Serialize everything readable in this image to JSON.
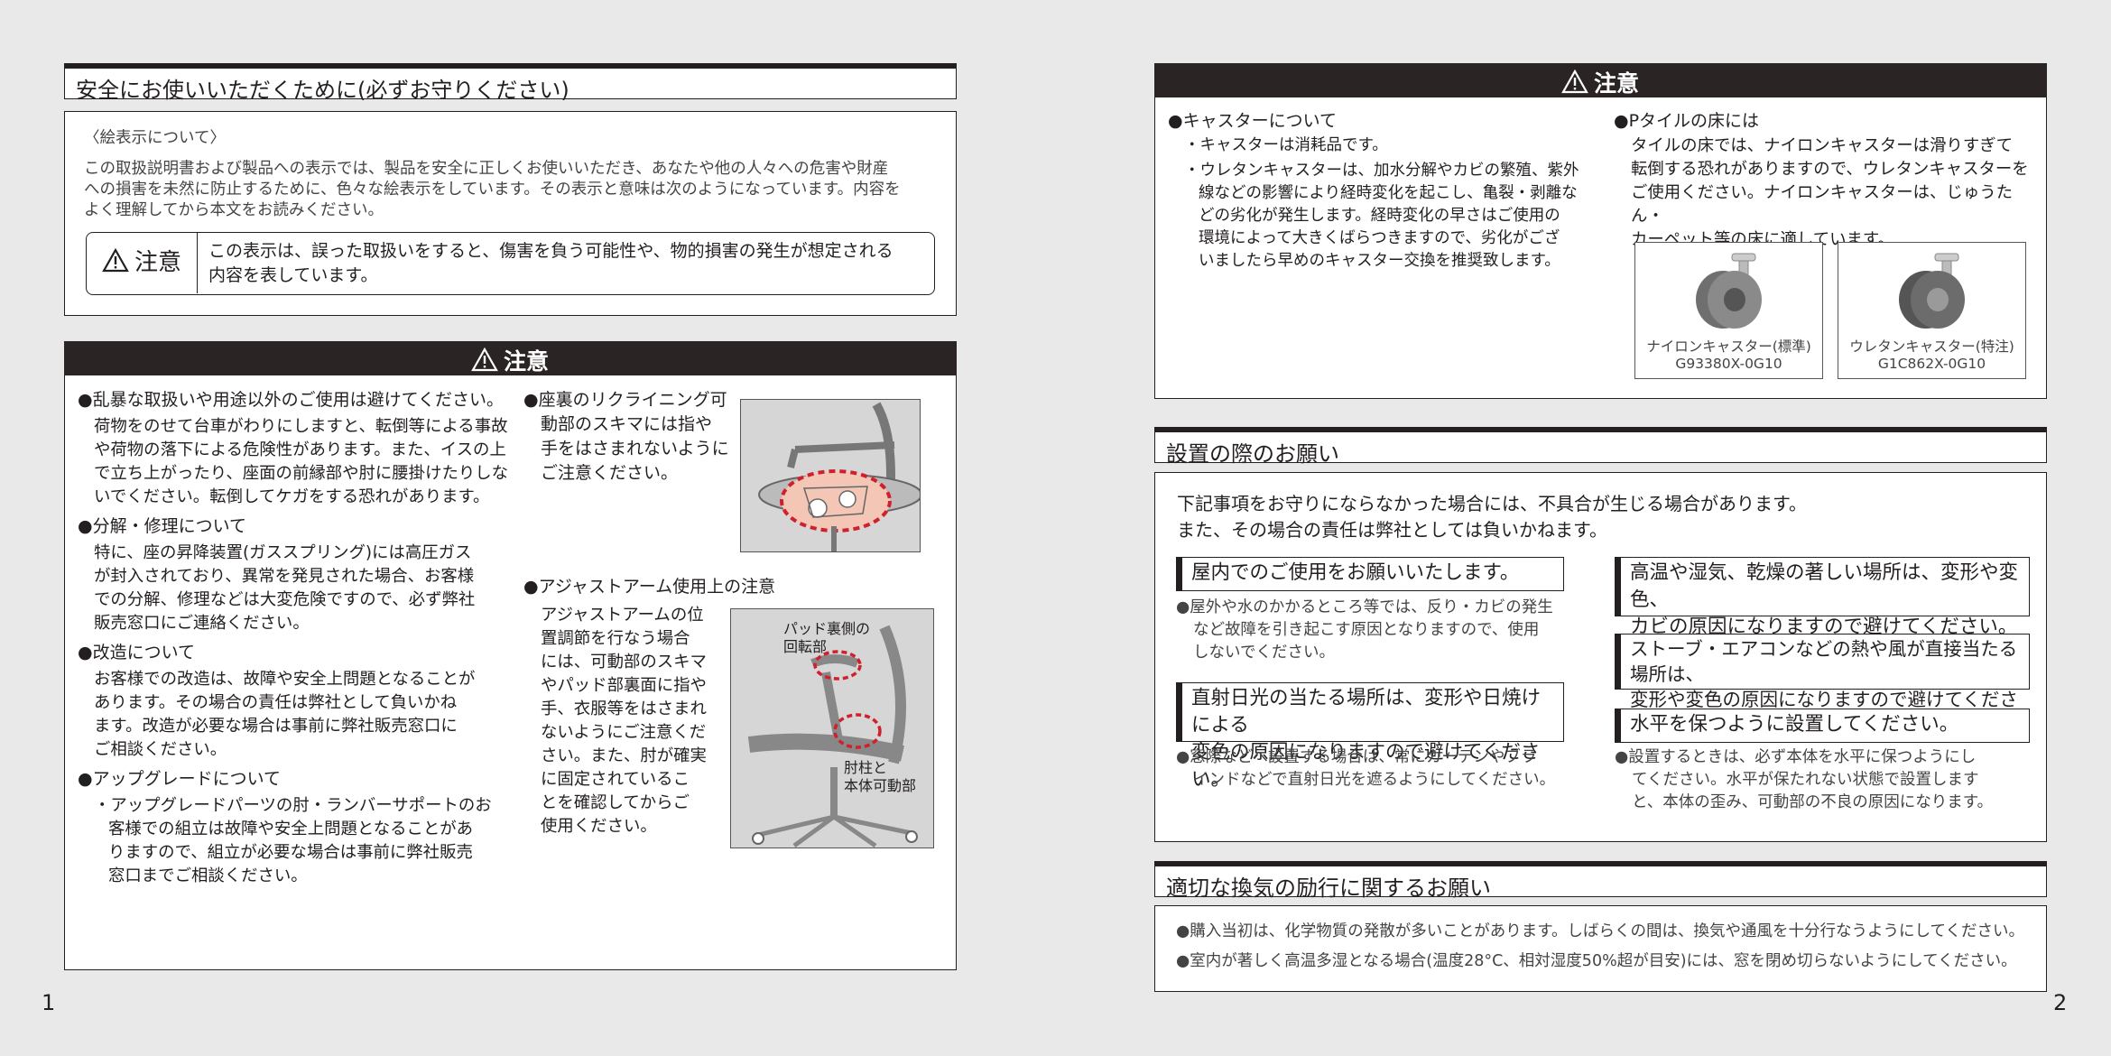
{
  "left": {
    "title": "安全にお使いいただくために(必ずお守りください)",
    "symbols": {
      "heading": "〈絵表示について〉",
      "line1": "この取扱説明書および製品への表示では、製品を安全に正しくお使いいただき、あなたや他の人々への危害や財産",
      "line2": "への損害を未然に防止するために、色々な絵表示をしています。その表示と意味は次のようになっています。内容を",
      "line3": "よく理解してから本文をお読みください。",
      "badge": "注意",
      "def1": "この表示は、誤った取扱いをすると、傷害を負う可能性や、物的損害の発生が想定される",
      "def2": "内容を表しています。"
    },
    "caution": {
      "header": "注意",
      "s1_head": "●乱暴な取扱いや用途以外のご使用は避けてください。",
      "s1_l1": "荷物をのせて台車がわりにしますと、転倒等による事故",
      "s1_l2": "や荷物の落下による危険性があります。また、イスの上",
      "s1_l3": "で立ち上がったり、座面の前縁部や肘に腰掛けたりしな",
      "s1_l4": "いでください。転倒してケガをする恐れがあります。",
      "s2_head": "●分解・修理について",
      "s2_l1": "特に、座の昇降装置(ガススプリング)には高圧ガス",
      "s2_l2": "が封入されており、異常を発見された場合、お客様",
      "s2_l3": "での分解、修理などは大変危険ですので、必ず弊社",
      "s2_l4": "販売窓口にご連絡ください。",
      "s3_head": "●改造について",
      "s3_l1": "お客様での改造は、故障や安全上問題となることが",
      "s3_l2": "あります。その場合の責任は弊社として負いかね",
      "s3_l3": "ます。改造が必要な場合は事前に弊社販売窓口に",
      "s3_l4": "ご相談ください。",
      "s4_head": "●アップグレードについて",
      "s4_l1": "・アップグレードパーツの肘・ランバーサポートのお",
      "s4_l2": "客様での組立は故障や安全上問題となることがあ",
      "s4_l3": "りますので、組立が必要な場合は事前に弊社販売",
      "s4_l4": "窓口までご相談ください。",
      "r1_l1": "●座裏のリクライニング可",
      "r1_l2": "動部のスキマには指や",
      "r1_l3": "手をはさまれないように",
      "r1_l4": "ご注意ください。",
      "r2_head": "●アジャストアーム使用上の注意",
      "r2_l1": "アジャストアームの位",
      "r2_l2": "置調節を行なう場合",
      "r2_l3": "には、可動部のスキマ",
      "r2_l4": "やパッド部裏面に指や",
      "r2_l5": "手、衣服等をはさまれ",
      "r2_l6": "ないようにご注意くだ",
      "r2_l7": "さい。また、肘が確実",
      "r2_l8": "に固定されているこ",
      "r2_l9": "とを確認してからご",
      "r2_l10": "使用ください。",
      "cap_pad1": "パッド裏側の",
      "cap_pad2": "回転部",
      "cap_arm1": "肘柱と",
      "cap_arm2": "本体可動部"
    },
    "page": "1"
  },
  "right": {
    "caution_header": "注意",
    "caster": {
      "head": "●キャスターについて",
      "l1": "・キャスターは消耗品です。",
      "l2": "・ウレタンキャスターは、加水分解やカビの繁殖、紫外",
      "l3": "線などの影響により経時変化を起こし、亀裂・剥離な",
      "l4": "どの劣化が発生します。経時変化の早さはご使用の",
      "l5": "環境によって大きくばらつきますので、劣化がござ",
      "l6": "いましたら早めのキャスター交換を推奨致します。"
    },
    "ptile": {
      "head": "●Pタイルの床には",
      "l1": "タイルの床では、ナイロンキャスターは滑りすぎて",
      "l2": "転倒する恐れがありますので、ウレタンキャスターを",
      "l3": "ご使用ください。ナイロンキャスターは、じゅうたん・",
      "l4": "カーペット等の床に適しています。",
      "nylon_name": "ナイロンキャスター(標準)",
      "nylon_code": "G93380X-0G10",
      "urethane_name": "ウレタンキャスター(特注)",
      "urethane_code": "G1C862X-0G10"
    },
    "install": {
      "title": "設置の際のお願い",
      "intro1": "下記事項をお守りにならなかった場合には、不具合が生じる場合があります。",
      "intro2": "また、その場合の責任は弊社としては負いかねます。",
      "a_head": "屋内でのご使用をお願いいたします。",
      "a_l1": "●屋外や水のかかるところ等では、反り・カビの発生",
      "a_l2": "など故障を引き起こす原因となりますので、使用",
      "a_l3": "しないでください。",
      "b_head1": "直射日光の当たる場所は、変形や日焼けによる",
      "b_head2": "変色の原因になりますので避けてください。",
      "b_l1": "●窓際などへ設置する場合は、常にカーテンやブラ",
      "b_l2": "インドなどで直射日光を遮るようにしてください。",
      "c_head1": "高温や湿気、乾燥の著しい場所は、変形や変色、",
      "c_head2": "カビの原因になりますので避けてください。",
      "d_head1": "ストーブ・エアコンなどの熱や風が直接当たる場所は、",
      "d_head2": "変形や変色の原因になりますので避けてください。",
      "e_head": "水平を保つように設置してください。",
      "e_l1": "●設置するときは、必ず本体を水平に保つようにし",
      "e_l2": "てください。水平が保たれない状態で設置します",
      "e_l3": "と、本体の歪み、可動部の不良の原因になります。"
    },
    "vent": {
      "title": "適切な換気の励行に関するお願い",
      "l1": "●購入当初は、化学物質の発散が多いことがあります。しばらくの間は、換気や通風を十分行なうようにしてください。",
      "l2": "●室内が著しく高温多湿となる場合(温度28°C、相対湿度50%超が目安)には、窓を閉め切らないようにしてください。"
    },
    "page": "2"
  }
}
